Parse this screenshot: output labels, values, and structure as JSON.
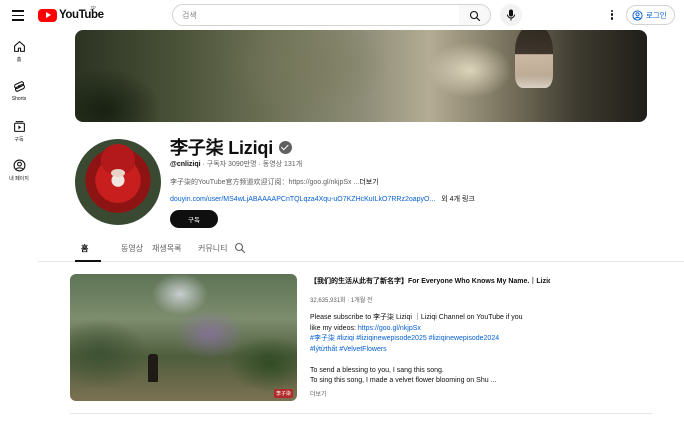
{
  "header": {
    "logo_text": "YouTube",
    "logo_region": "JP",
    "search": {
      "placeholder": "검색",
      "value": ""
    },
    "signin_label": "로그인"
  },
  "guide": {
    "items": [
      {
        "label": "홈",
        "icon": "home-icon"
      },
      {
        "label": "Shorts",
        "icon": "shorts-icon"
      },
      {
        "label": "구독",
        "icon": "subscriptions-icon"
      },
      {
        "label": "내 페이지",
        "icon": "you-icon"
      }
    ]
  },
  "channel": {
    "name": "李子柒 Liziqi",
    "handle": "@cnliziqi",
    "subscribers": "구독자 3090만명",
    "videos_count": "동영상 131개",
    "description": "李子柒的YouTube官方频道欢迎订阅：https://goo.gl/nkjpSx ...",
    "description_more": "더보기",
    "link": "douyin.com/user/MS4wLjABAAAAPCnTQLqza4Xqu-uO7KZHcKuILkO7RRz2oapyO...",
    "link_extra": "외 4개 링크",
    "subscribe_label": "구독"
  },
  "tabs": [
    {
      "label": "홈",
      "active": true
    },
    {
      "label": "동영상",
      "active": false
    },
    {
      "label": "재생목록",
      "active": false
    },
    {
      "label": "커뮤니티",
      "active": false
    }
  ],
  "featured": {
    "title": "【我们的生活从此有了新名字】For Everyone Who Knows My Name.｜Liziqi C...",
    "views": "32,635,931회",
    "age": "1개월 전",
    "description_lines": [
      {
        "text": "Please  subscribe to 李子柒 Liziqi ｜Liziqi Channel on YouTube if you",
        "type": "text"
      },
      {
        "text": "like my videos: ",
        "type": "text",
        "link": "https://goo.gl/nkjpSx"
      },
      {
        "text": "#李子柒 #liziqi #liziqinewepisode2025 #liziqinewepisode2024",
        "type": "link"
      },
      {
        "text": "#lýtửthất #VelvetFlowers",
        "type": "link"
      },
      {
        "text": "",
        "type": "blank"
      },
      {
        "text": "To send a blessing to you, I sang this song.",
        "type": "text"
      },
      {
        "text": "To sing this song, I made a velvet flower blooming on Shu ...",
        "type": "text"
      }
    ],
    "more_label": "더보기",
    "watermark": "李子柒"
  },
  "colors": {
    "accent": "#065fd4",
    "brand_red": "#ff0000",
    "subscribe_bg": "#0f0f0f"
  }
}
